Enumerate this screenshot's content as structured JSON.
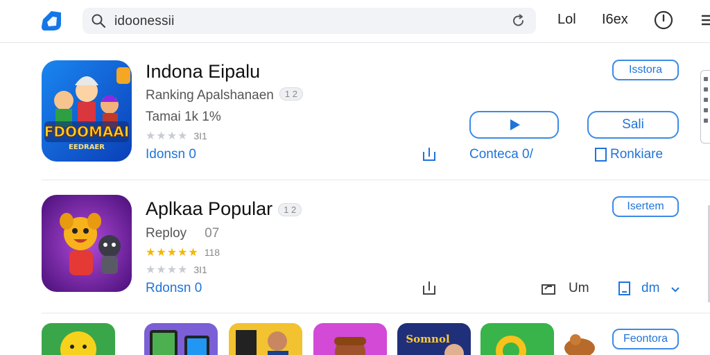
{
  "header": {
    "search_text": "idoonessii",
    "link_1": "Lol",
    "link_2": "I6ex",
    "icons": [
      "store-logo-icon",
      "search-icon",
      "reload-icon",
      "timer-icon",
      "menu-icon"
    ]
  },
  "apps": [
    {
      "title": "Indona Eipalu",
      "subtitle": "Ranking Apalshanaen",
      "subtitle_badge": "1 2",
      "meta": "Tamai 1k 1%",
      "rating_count": "3I1",
      "rating_stars": 0,
      "developer": "Idonsn 0",
      "tag_button": "Isstora",
      "play_button_icon": "play-icon",
      "get_button": "Sali",
      "share_icon": "share-icon",
      "action_1": "Conteca 0/",
      "action_2": "Ronkiare",
      "icon_text_1": "FDOOMAAI",
      "icon_text_2": "EEDRAER"
    },
    {
      "title": "Aplkaa Popular",
      "title_badge": "1 2",
      "subtitle": "Reploy",
      "subtitle_extra": "07",
      "rating_primary_count": "118",
      "rating_primary_stars": 5,
      "rating_count": "3I1",
      "rating_stars": 0,
      "developer": "Rdonsn 0",
      "tag_button": "Isertem",
      "share_icon": "share-icon",
      "action_1": "Um",
      "action_2": "dm"
    }
  ],
  "bottom_row": {
    "tag_button": "Feontora",
    "thumb_text": "Somnol"
  },
  "colors": {
    "accent": "#1f73d9",
    "star": "#f5b800",
    "star_empty": "#c8ccd2"
  }
}
